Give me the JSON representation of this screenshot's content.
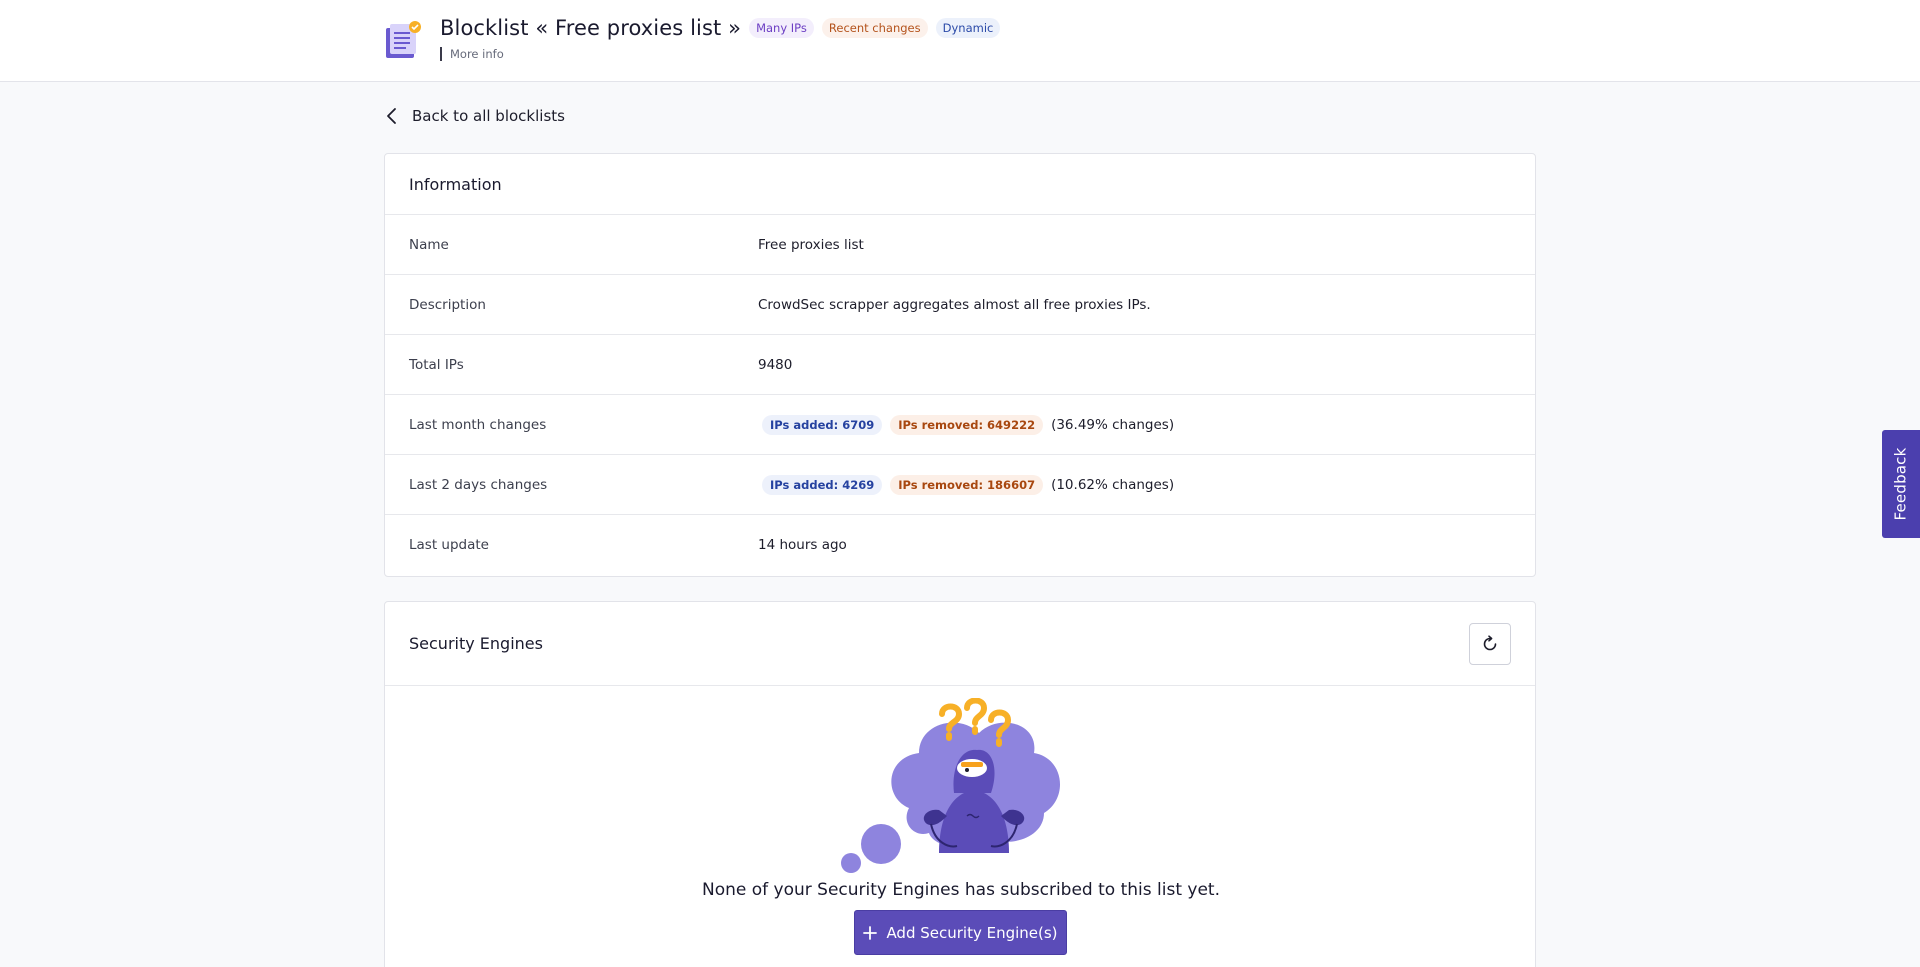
{
  "header": {
    "title": "Blocklist « Free proxies list »",
    "tags": [
      "Many IPs",
      "Recent changes",
      "Dynamic"
    ],
    "more_info": "More info",
    "logo_icon": "blocklist-document-icon"
  },
  "back_link": {
    "label": "Back to all blocklists",
    "icon": "chevron-left-icon"
  },
  "information": {
    "title": "Information",
    "rows": {
      "name": {
        "label": "Name",
        "value": "Free proxies list"
      },
      "description": {
        "label": "Description",
        "value": "CrowdSec scrapper aggregates almost all free proxies IPs."
      },
      "total_ips": {
        "label": "Total IPs",
        "value": "9480"
      },
      "last_month": {
        "label": "Last month changes",
        "added": "IPs added: 6709",
        "removed": "IPs removed: 649222",
        "pct": "(36.49% changes)"
      },
      "last_2_days": {
        "label": "Last 2 days changes",
        "added": "IPs added: 4269",
        "removed": "IPs removed: 186607",
        "pct": "(10.62% changes)"
      },
      "last_update": {
        "label": "Last update",
        "value": "14 hours ago"
      }
    }
  },
  "security_engines": {
    "title": "Security Engines",
    "refresh_icon": "refresh-icon",
    "empty_message": "None of your Security Engines has subscribed to this list yet.",
    "add_button": "Add Security Engine(s)",
    "add_icon": "plus-icon"
  },
  "feedback": {
    "label": "Feedback"
  },
  "colors": {
    "primary": "#5b4cb8",
    "feedback": "#4b3fae",
    "added": "#2642a0",
    "removed": "#a8470f"
  }
}
